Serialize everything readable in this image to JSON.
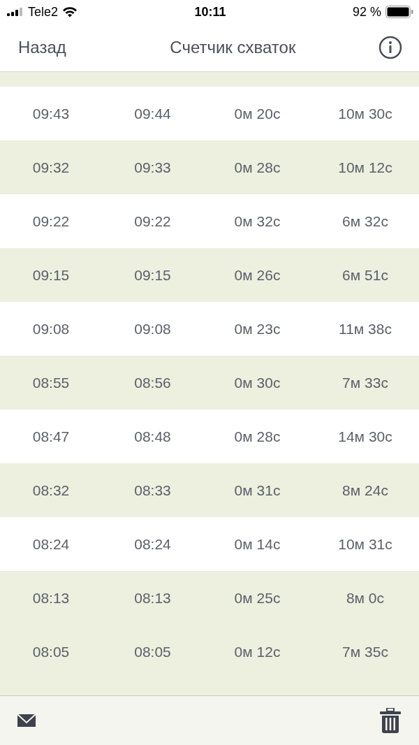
{
  "status_bar": {
    "carrier": "Tele2",
    "time": "10:11",
    "battery": "92 %"
  },
  "nav": {
    "back": "Назад",
    "title": "Счетчик схваток"
  },
  "rows": [
    {
      "start": "09:43",
      "end": "09:44",
      "duration": "0м 20с",
      "interval": "10м 30с",
      "shaded": false
    },
    {
      "start": "09:32",
      "end": "09:33",
      "duration": "0м 28с",
      "interval": "10м 12с",
      "shaded": true
    },
    {
      "start": "09:22",
      "end": "09:22",
      "duration": "0м 32с",
      "interval": "6м 32с",
      "shaded": false
    },
    {
      "start": "09:15",
      "end": "09:15",
      "duration": "0м 26с",
      "interval": "6м 51с",
      "shaded": true
    },
    {
      "start": "09:08",
      "end": "09:08",
      "duration": "0м 23с",
      "interval": "11м 38с",
      "shaded": false
    },
    {
      "start": "08:55",
      "end": "08:56",
      "duration": "0м 30с",
      "interval": "7м 33с",
      "shaded": true
    },
    {
      "start": "08:47",
      "end": "08:48",
      "duration": "0м 28с",
      "interval": "14м 30с",
      "shaded": false
    },
    {
      "start": "08:32",
      "end": "08:33",
      "duration": "0м 31с",
      "interval": "8м 24с",
      "shaded": true
    },
    {
      "start": "08:24",
      "end": "08:24",
      "duration": "0м 14с",
      "interval": "10м 31с",
      "shaded": false
    },
    {
      "start": "08:13",
      "end": "08:13",
      "duration": "0м 25с",
      "interval": "8м 0с",
      "shaded": true
    },
    {
      "start": "08:05",
      "end": "08:05",
      "duration": "0м 12с",
      "interval": "7м 35с",
      "shaded": true
    }
  ]
}
